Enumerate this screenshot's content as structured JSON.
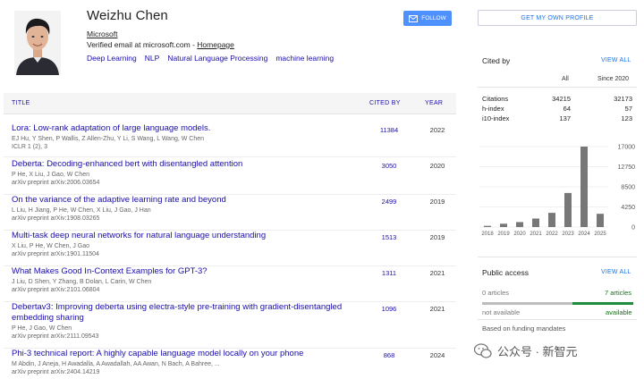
{
  "profile": {
    "name": "Weizhu Chen",
    "affiliation": "Microsoft",
    "verified_prefix": "Verified email at microsoft.com - ",
    "homepage_label": "Homepage",
    "interests": [
      "Deep Learning",
      "NLP",
      "Natural Language Processing",
      "machine learning"
    ]
  },
  "buttons": {
    "follow": "FOLLOW",
    "get_profile": "GET MY OWN PROFILE"
  },
  "table": {
    "headers": {
      "title": "TITLE",
      "cited_by": "CITED BY",
      "year": "YEAR"
    },
    "rows": [
      {
        "title": "Lora: Low-rank adaptation of large language models.",
        "authors": "EJ Hu, Y Shen, P Wallis, Z Allen-Zhu, Y Li, S Wang, L Wang, W Chen",
        "venue": "ICLR 1 (2), 3",
        "cited": "11384",
        "year": "2022"
      },
      {
        "title": "Deberta: Decoding-enhanced bert with disentangled attention",
        "authors": "P He, X Liu, J Gao, W Chen",
        "venue": "arXiv preprint arXiv:2006.03654",
        "cited": "3050",
        "year": "2020"
      },
      {
        "title": "On the variance of the adaptive learning rate and beyond",
        "authors": "L Liu, H Jiang, P He, W Chen, X Liu, J Gao, J Han",
        "venue": "arXiv preprint arXiv:1908.03265",
        "cited": "2499",
        "year": "2019"
      },
      {
        "title": "Multi-task deep neural networks for natural language understanding",
        "authors": "X Liu, P He, W Chen, J Gao",
        "venue": "arXiv preprint arXiv:1901.11504",
        "cited": "1513",
        "year": "2019"
      },
      {
        "title": "What Makes Good In-Context Examples for GPT-3?",
        "authors": "J Liu, D Shen, Y Zhang, B Dolan, L Carin, W Chen",
        "venue": "arXiv preprint arXiv:2101.06804",
        "cited": "1311",
        "year": "2021"
      },
      {
        "title": "Debertav3: Improving deberta using electra-style pre-training with gradient-disentangled embedding sharing",
        "authors": "P He, J Gao, W Chen",
        "venue": "arXiv preprint arXiv:2111.09543",
        "cited": "1096",
        "year": "2021"
      },
      {
        "title": "Phi-3 technical report: A highly capable language model locally on your phone",
        "authors": "M Abdin, J Aneja, H Awadalla, A Awadallah, AA Awan, N Bach, A Bahree, ...",
        "venue": "arXiv preprint arXiv:2404.14219",
        "cited": "868",
        "year": "2024"
      }
    ]
  },
  "cited_by": {
    "label": "Cited by",
    "view_all": "VIEW ALL",
    "col_all": "All",
    "col_since": "Since 2020",
    "rows": [
      {
        "label": "Citations",
        "all": "34215",
        "since": "32173"
      },
      {
        "label": "h-index",
        "all": "64",
        "since": "57"
      },
      {
        "label": "i10-index",
        "all": "137",
        "since": "123"
      }
    ]
  },
  "chart_data": {
    "type": "bar",
    "categories": [
      "2018",
      "2019",
      "2020",
      "2021",
      "2022",
      "2023",
      "2024",
      "2025"
    ],
    "values": [
      250,
      700,
      1050,
      1800,
      3000,
      7200,
      17000,
      2800
    ],
    "ylim": [
      0,
      17000
    ],
    "yticks": [
      "17000",
      "12750",
      "8500",
      "4250",
      "0"
    ],
    "bar_color": "#777777"
  },
  "public_access": {
    "label": "Public access",
    "view_all": "VIEW ALL",
    "left_count": "0 articles",
    "right_count": "7 articles",
    "left_status": "not available",
    "right_status": "available",
    "mandates": "Based on funding mandates"
  },
  "watermark": {
    "text": "公众号 · 新智元"
  }
}
